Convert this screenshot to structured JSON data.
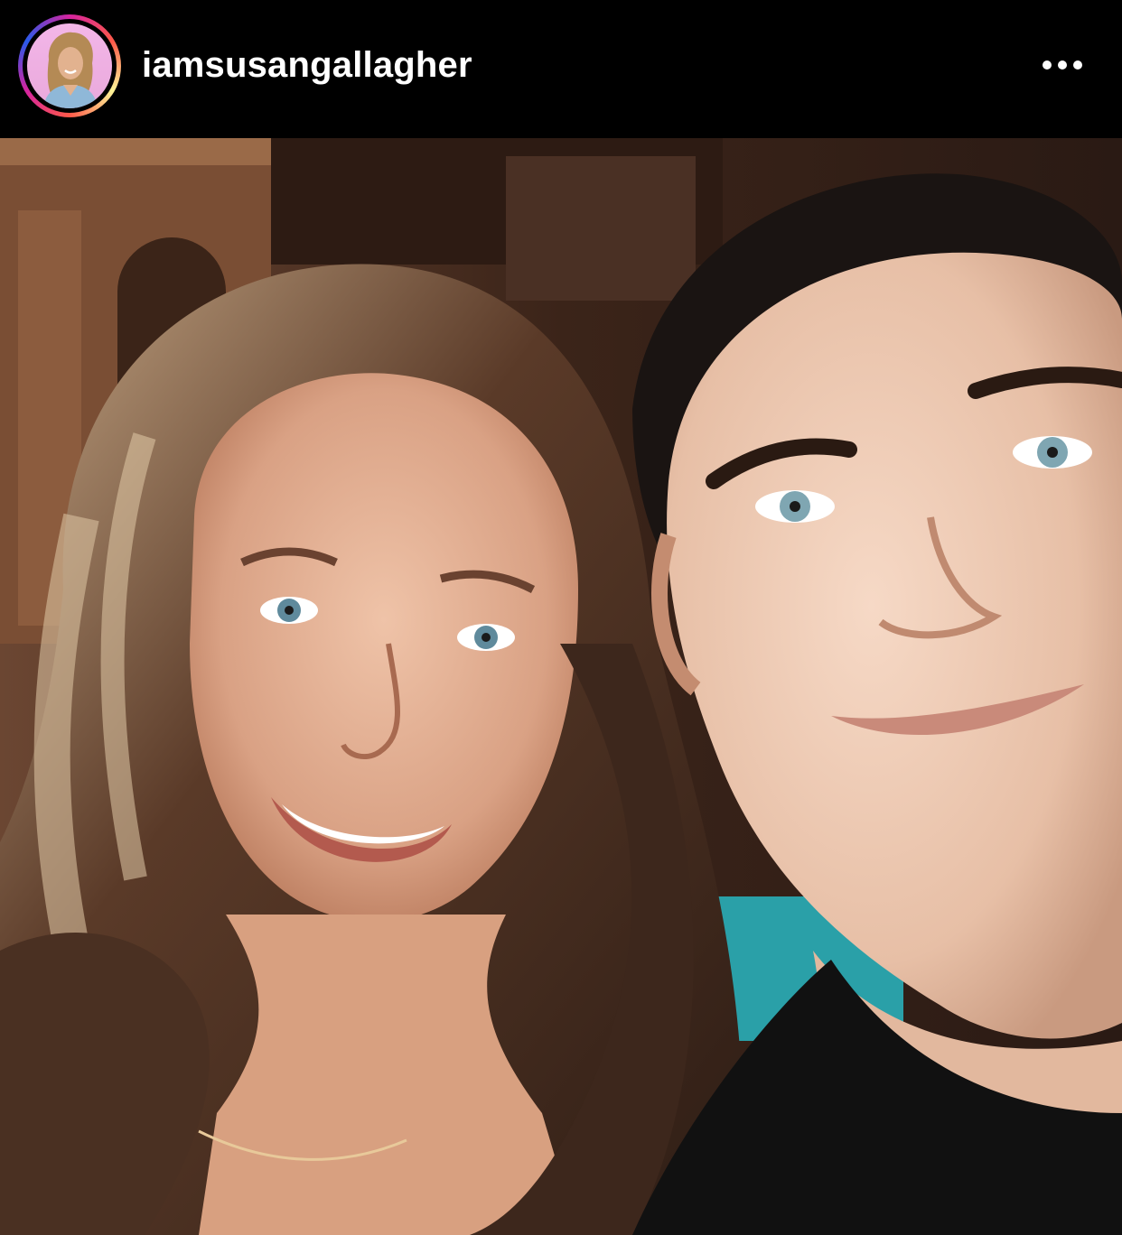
{
  "post": {
    "username": "iamsusangallagher",
    "avatar_icon": "profile-photo-avatar",
    "more_icon": "more-options-icon",
    "story_ring_colors": [
      "#d6249f",
      "#fd5949",
      "#fdf497",
      "#285AEB"
    ],
    "photo_description_icon": "selfie-photo"
  }
}
